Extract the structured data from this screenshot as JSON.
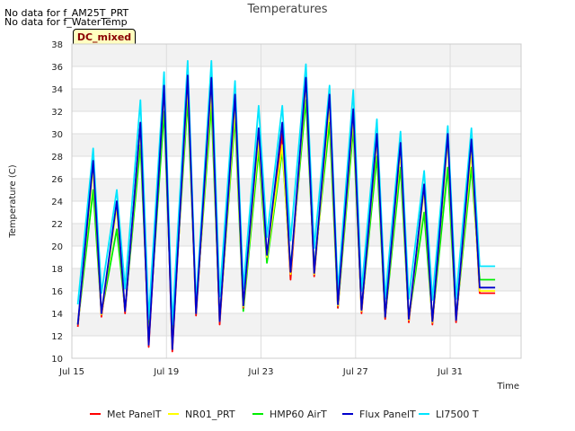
{
  "notes": [
    "No data for f_AM25T_PRT",
    "No data for f_WaterTemp"
  ],
  "badge": "DC_mixed",
  "colors": {
    "Met PanelT": "#ff0000",
    "NR01_PRT": "#ffff00",
    "HMP60 AirT": "#00ee00",
    "Flux PanelT": "#0000cc",
    "LI7500 T": "#00e5ff",
    "band": "#f2f2f2",
    "grid": "#dddddd"
  },
  "chart_data": {
    "type": "line",
    "title": "Temperatures",
    "xlabel": "Time",
    "ylabel": "Temperature (C)",
    "xlim": [
      "Jul 15",
      "Aug 3"
    ],
    "ylim": [
      10,
      38
    ],
    "yticks": [
      10,
      12,
      14,
      16,
      18,
      20,
      22,
      24,
      26,
      28,
      30,
      32,
      34,
      36,
      38
    ],
    "xticks": [
      "Jul 15",
      "Jul 19",
      "Jul 23",
      "Jul 27",
      "Jul 31"
    ],
    "grid": true,
    "legend_position": "bottom",
    "x_dates": [
      "Jul 15",
      "Jul 15",
      "Jul 16",
      "Jul 16",
      "Jul 17",
      "Jul 17",
      "Jul 18",
      "Jul 18",
      "Jul 19",
      "Jul 19",
      "Jul 20",
      "Jul 20",
      "Jul 21",
      "Jul 21",
      "Jul 22",
      "Jul 22",
      "Jul 23",
      "Jul 23",
      "Jul 24",
      "Jul 24",
      "Jul 25",
      "Jul 25",
      "Jul 26",
      "Jul 26",
      "Jul 27",
      "Jul 27",
      "Jul 28",
      "Jul 28",
      "Jul 29",
      "Jul 29",
      "Jul 30",
      "Jul 30",
      "Jul 31",
      "Jul 31",
      "Aug 1",
      "Aug 1"
    ],
    "x_days": [
      0.25,
      0.9,
      1.25,
      1.9,
      2.25,
      2.9,
      3.25,
      3.9,
      4.25,
      4.9,
      5.25,
      5.9,
      6.25,
      6.9,
      7.25,
      7.9,
      8.25,
      8.9,
      9.25,
      9.9,
      10.25,
      10.9,
      11.25,
      11.9,
      12.25,
      12.9,
      13.25,
      13.9,
      14.25,
      14.9,
      15.25,
      15.9,
      16.25,
      16.9,
      17.25,
      17.9
    ],
    "series": [
      {
        "name": "Met PanelT",
        "values": [
          12.8,
          27.5,
          13.7,
          23.8,
          14.0,
          31.0,
          11.0,
          34.5,
          10.6,
          35.0,
          13.8,
          34.5,
          13.0,
          33.0,
          14.5,
          30.0,
          19.0,
          30.0,
          17.0,
          35.0,
          17.3,
          33.0,
          14.5,
          32.0,
          14.0,
          30.0,
          13.5,
          29.0,
          13.2,
          25.5,
          13.0,
          30.0,
          13.2,
          29.0,
          15.8,
          15.8
        ]
      },
      {
        "name": "NR01_PRT",
        "values": [
          13.0,
          27.0,
          13.9,
          23.5,
          14.2,
          30.5,
          11.5,
          34.0,
          11.0,
          34.5,
          14.0,
          34.0,
          13.3,
          32.5,
          14.6,
          29.5,
          19.0,
          29.0,
          17.5,
          34.5,
          17.5,
          32.5,
          14.7,
          31.5,
          14.2,
          29.5,
          13.7,
          28.5,
          13.4,
          25.0,
          13.2,
          29.5,
          13.4,
          28.5,
          16.0,
          16.0
        ]
      },
      {
        "name": "HMP60 AirT",
        "values": [
          13.0,
          25.0,
          14.0,
          21.5,
          14.3,
          29.0,
          12.0,
          32.0,
          12.0,
          33.0,
          14.5,
          32.5,
          13.5,
          31.5,
          14.2,
          28.5,
          18.5,
          28.5,
          18.0,
          33.0,
          18.0,
          31.0,
          14.5,
          30.5,
          14.3,
          28.0,
          13.6,
          27.0,
          13.5,
          23.0,
          13.3,
          27.0,
          13.5,
          27.0,
          17.0,
          17.0
        ]
      },
      {
        "name": "Flux PanelT",
        "values": [
          13.0,
          27.6,
          14.0,
          24.0,
          14.2,
          31.0,
          11.2,
          34.3,
          10.8,
          35.2,
          14.0,
          35.0,
          13.3,
          33.5,
          14.7,
          30.5,
          19.2,
          31.0,
          17.7,
          35.0,
          17.6,
          33.5,
          14.8,
          32.2,
          14.3,
          30.0,
          13.7,
          29.2,
          13.5,
          25.5,
          13.3,
          30.0,
          13.4,
          29.5,
          16.3,
          16.3
        ]
      },
      {
        "name": "LI7500 T",
        "values": [
          14.8,
          28.7,
          15.8,
          25.0,
          16.2,
          33.0,
          13.5,
          35.5,
          13.0,
          36.5,
          14.8,
          36.5,
          15.5,
          34.7,
          16.2,
          32.5,
          20.8,
          32.5,
          20.5,
          36.2,
          19.8,
          34.3,
          16.0,
          33.9,
          16.0,
          31.3,
          15.3,
          30.2,
          15.3,
          26.7,
          15.2,
          30.7,
          15.3,
          30.5,
          18.2,
          18.2
        ]
      }
    ]
  }
}
